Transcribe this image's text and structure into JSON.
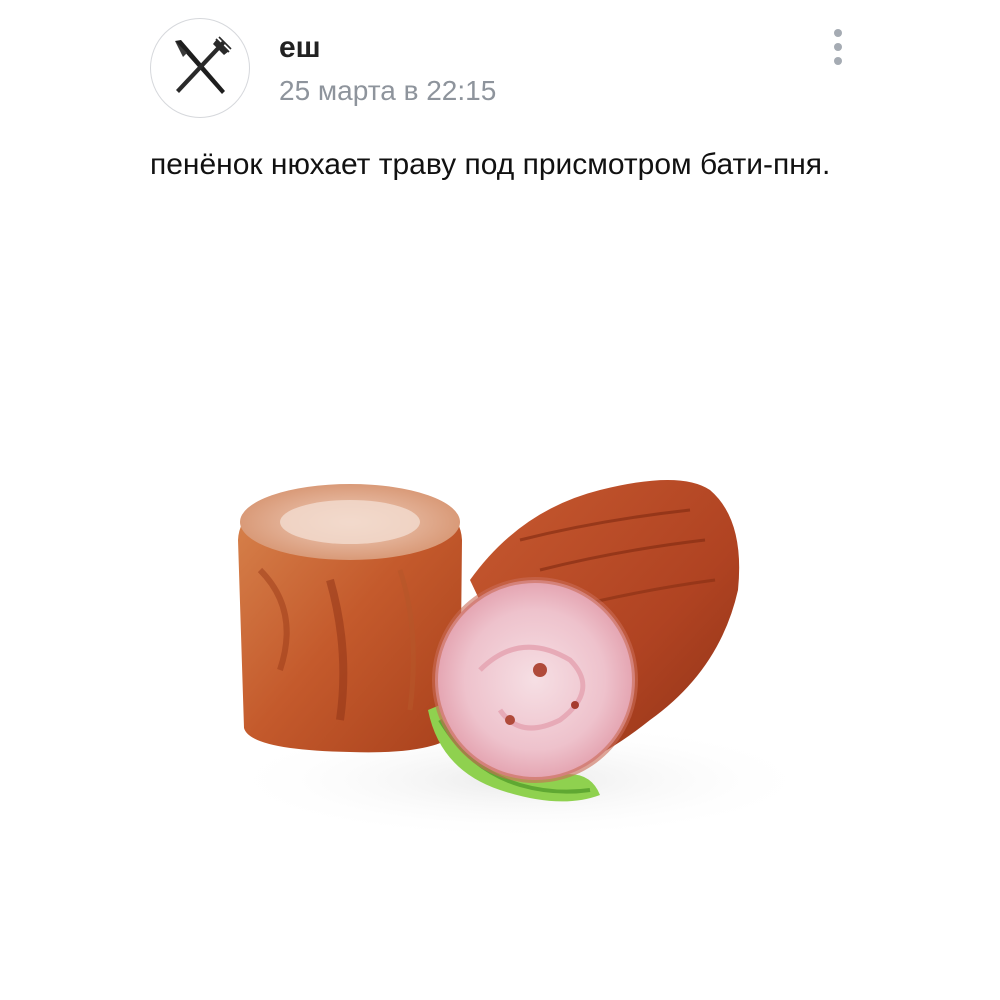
{
  "post": {
    "author": {
      "name": "еш",
      "avatar_icon": "fork-knife-crossed-icon"
    },
    "date": "25 марта в 22:15",
    "menu_icon": "more-vertical-icon",
    "text": "пенёнок нюхает траву под присмотром бати-пня.",
    "image": {
      "subject": "meat-roll-photo"
    }
  },
  "colors": {
    "date": "#8e949c",
    "menu_dots": "#a5abb3",
    "avatar_border": "#d6d8dc"
  }
}
